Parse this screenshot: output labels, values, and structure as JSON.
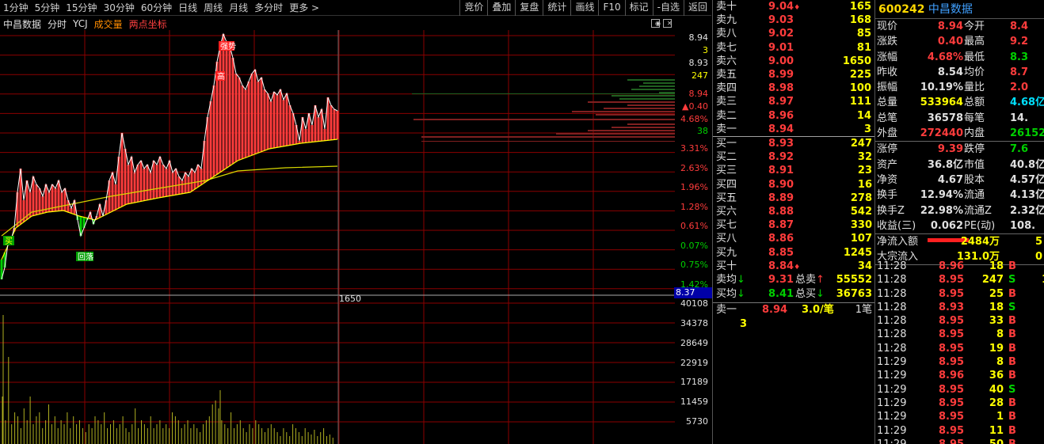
{
  "toolbar": {
    "periods": [
      "1分钟",
      "5分钟",
      "15分钟",
      "30分钟",
      "60分钟",
      "日线",
      "周线",
      "月线",
      "多分时",
      "更多 >"
    ],
    "tools": [
      "竞价",
      "叠加",
      "复盘",
      "统计",
      "画线",
      "F10",
      "标记",
      "-自选",
      "返回"
    ]
  },
  "chart_header": {
    "stock_name": "中昌数据",
    "mode": "分时",
    "ycj": "YCJ",
    "volume_label": "成交量",
    "two_point": "两点坐标"
  },
  "chart_annotations": {
    "strong_tag": "强势",
    "high_tag": "高",
    "pullback_tag": "回落",
    "buy_tag": "买",
    "volume_marker": "1650"
  },
  "price_axis": {
    "labels": [
      "8.94",
      "3",
      "8.93",
      "247",
      "8.94",
      "▲0.40",
      "4.68%",
      "38",
      "3.31%",
      "2.63%",
      "1.96%",
      "1.28%",
      "0.61%",
      "0.07%",
      "0.75%",
      "1.42%"
    ],
    "current_price": "8.37"
  },
  "volume_axis": {
    "labels": [
      "40108",
      "34378",
      "28649",
      "22919",
      "17189",
      "11459",
      "5730"
    ]
  },
  "colors": {
    "up": "#ff3c3c",
    "down": "#00d000",
    "price_line": "#ffffff",
    "avg_line": "#ffff00",
    "volume_bar": "#b0b020",
    "label_yellow": "#ffff00",
    "grid": "#8b0000"
  },
  "order_book": {
    "sell": [
      {
        "label": "卖十",
        "price": "9.04",
        "mark": "♦",
        "volume": "165"
      },
      {
        "label": "卖九",
        "price": "9.03",
        "mark": "",
        "volume": "168"
      },
      {
        "label": "卖八",
        "price": "9.02",
        "mark": "",
        "volume": "85"
      },
      {
        "label": "卖七",
        "price": "9.01",
        "mark": "",
        "volume": "81"
      },
      {
        "label": "卖六",
        "price": "9.00",
        "mark": "",
        "volume": "1650"
      },
      {
        "label": "卖五",
        "price": "8.99",
        "mark": "",
        "volume": "225"
      },
      {
        "label": "卖四",
        "price": "8.98",
        "mark": "",
        "volume": "100"
      },
      {
        "label": "卖三",
        "price": "8.97",
        "mark": "",
        "volume": "111"
      },
      {
        "label": "卖二",
        "price": "8.96",
        "mark": "",
        "volume": "14"
      },
      {
        "label": "卖一",
        "price": "8.94",
        "mark": "",
        "volume": "3"
      }
    ],
    "buy": [
      {
        "label": "买一",
        "price": "8.93",
        "mark": "",
        "volume": "247"
      },
      {
        "label": "买二",
        "price": "8.92",
        "mark": "",
        "volume": "32"
      },
      {
        "label": "买三",
        "price": "8.91",
        "mark": "",
        "volume": "23"
      },
      {
        "label": "买四",
        "price": "8.90",
        "mark": "",
        "volume": "16"
      },
      {
        "label": "买五",
        "price": "8.89",
        "mark": "",
        "volume": "278"
      },
      {
        "label": "买六",
        "price": "8.88",
        "mark": "",
        "volume": "542"
      },
      {
        "label": "买七",
        "price": "8.87",
        "mark": "",
        "volume": "330"
      },
      {
        "label": "买八",
        "price": "8.86",
        "mark": "",
        "volume": "107"
      },
      {
        "label": "买九",
        "price": "8.85",
        "mark": "",
        "volume": "1245"
      },
      {
        "label": "买十",
        "price": "8.84",
        "mark": "♦",
        "volume": "34"
      }
    ],
    "summary": [
      {
        "l1": "卖均",
        "arrow1": "↓",
        "v1": "9.31",
        "l2": "总卖",
        "arrow2": "↑",
        "v2": "55552"
      },
      {
        "l1": "买均",
        "arrow1": "↓",
        "v1": "8.41",
        "l2": "总买",
        "arrow2": "↓",
        "v2": "36763"
      }
    ],
    "last": {
      "label": "卖一",
      "price": "8.94",
      "qty": "3.0/笔",
      "count": "1笔"
    },
    "last_qty": "3"
  },
  "stats": {
    "code": "600242",
    "name": "中昌数据",
    "rows1": [
      {
        "a": "现价",
        "av": "8.94",
        "ac": "red",
        "b": "今开",
        "bv": "8.4",
        "bc": "red"
      },
      {
        "a": "涨跌",
        "av": "0.40",
        "ac": "red",
        "b": "最高",
        "bv": "9.2",
        "bc": "red"
      },
      {
        "a": "涨幅",
        "av": "4.68%",
        "ac": "red",
        "b": "最低",
        "bv": "8.3",
        "bc": "green"
      },
      {
        "a": "昨收",
        "av": "8.54",
        "ac": "white",
        "b": "均价",
        "bv": "8.7",
        "bc": "red"
      },
      {
        "a": "振幅",
        "av": "10.19%",
        "ac": "white",
        "b": "量比",
        "bv": "2.0",
        "bc": "red"
      },
      {
        "a": "总量",
        "av": "533964",
        "ac": "yellow",
        "b": "总额",
        "bv": "4.68亿",
        "bc": "cyan"
      },
      {
        "a": "总笔",
        "av": "36578",
        "ac": "white",
        "b": "每笔",
        "bv": "14.",
        "bc": "white"
      },
      {
        "a": "外盘",
        "av": "272440",
        "ac": "red",
        "b": "内盘",
        "bv": "26152",
        "bc": "green"
      }
    ],
    "rows2": [
      {
        "a": "涨停",
        "av": "9.39",
        "ac": "red",
        "b": "跌停",
        "bv": "7.6",
        "bc": "green"
      },
      {
        "a": "资产",
        "av": "36.8亿",
        "ac": "white",
        "b": "市值",
        "bv": "40.8亿",
        "bc": "white"
      },
      {
        "a": "净资",
        "av": "4.67",
        "ac": "white",
        "b": "股本",
        "bv": "4.57亿",
        "bc": "white"
      },
      {
        "a": "换手",
        "av": "12.94%",
        "ac": "white",
        "b": "流通",
        "bv": "4.13亿",
        "bc": "white"
      },
      {
        "a": "换手Z",
        "av": "22.98%",
        "ac": "white",
        "b": "流通Z",
        "bv": "2.32亿",
        "bc": "white"
      },
      {
        "a": "收益(三)",
        "av": "0.062",
        "ac": "white",
        "b": "PE(动)",
        "bv": "108.",
        "bc": "white"
      }
    ],
    "flow": [
      {
        "a": "净流入额",
        "bar": true,
        "v": "2484万",
        "v3": "5"
      },
      {
        "a": "大宗流入",
        "bar": false,
        "v": "131.0万",
        "v3": "0"
      }
    ],
    "ticks": [
      {
        "t": "11:28",
        "p": "8.96",
        "q": "18",
        "s": "B",
        "sc": "red",
        "x": ""
      },
      {
        "t": "11:28",
        "p": "8.95",
        "q": "247",
        "s": "S",
        "sc": "green",
        "x": "1"
      },
      {
        "t": "11:28",
        "p": "8.95",
        "q": "25",
        "s": "B",
        "sc": "red",
        "x": ""
      },
      {
        "t": "11:28",
        "p": "8.93",
        "q": "18",
        "s": "S",
        "sc": "green",
        "x": ""
      },
      {
        "t": "11:28",
        "p": "8.95",
        "q": "33",
        "s": "B",
        "sc": "red",
        "x": ""
      },
      {
        "t": "11:28",
        "p": "8.95",
        "q": "8",
        "s": "B",
        "sc": "red",
        "x": ""
      },
      {
        "t": "11:28",
        "p": "8.95",
        "q": "19",
        "s": "B",
        "sc": "red",
        "x": ""
      },
      {
        "t": "11:29",
        "p": "8.95",
        "q": "8",
        "s": "B",
        "sc": "red",
        "x": ""
      },
      {
        "t": "11:29",
        "p": "8.96",
        "q": "36",
        "s": "B",
        "sc": "red",
        "x": ""
      },
      {
        "t": "11:29",
        "p": "8.95",
        "q": "40",
        "s": "S",
        "sc": "green",
        "x": ""
      },
      {
        "t": "11:29",
        "p": "8.95",
        "q": "28",
        "s": "B",
        "sc": "red",
        "x": ""
      },
      {
        "t": "11:29",
        "p": "8.95",
        "q": "1",
        "s": "B",
        "sc": "red",
        "x": ""
      },
      {
        "t": "11:29",
        "p": "8.95",
        "q": "11",
        "s": "B",
        "sc": "red",
        "x": ""
      },
      {
        "t": "11:29",
        "p": "8.95",
        "q": "50",
        "s": "B",
        "sc": "red",
        "x": ""
      }
    ]
  }
}
